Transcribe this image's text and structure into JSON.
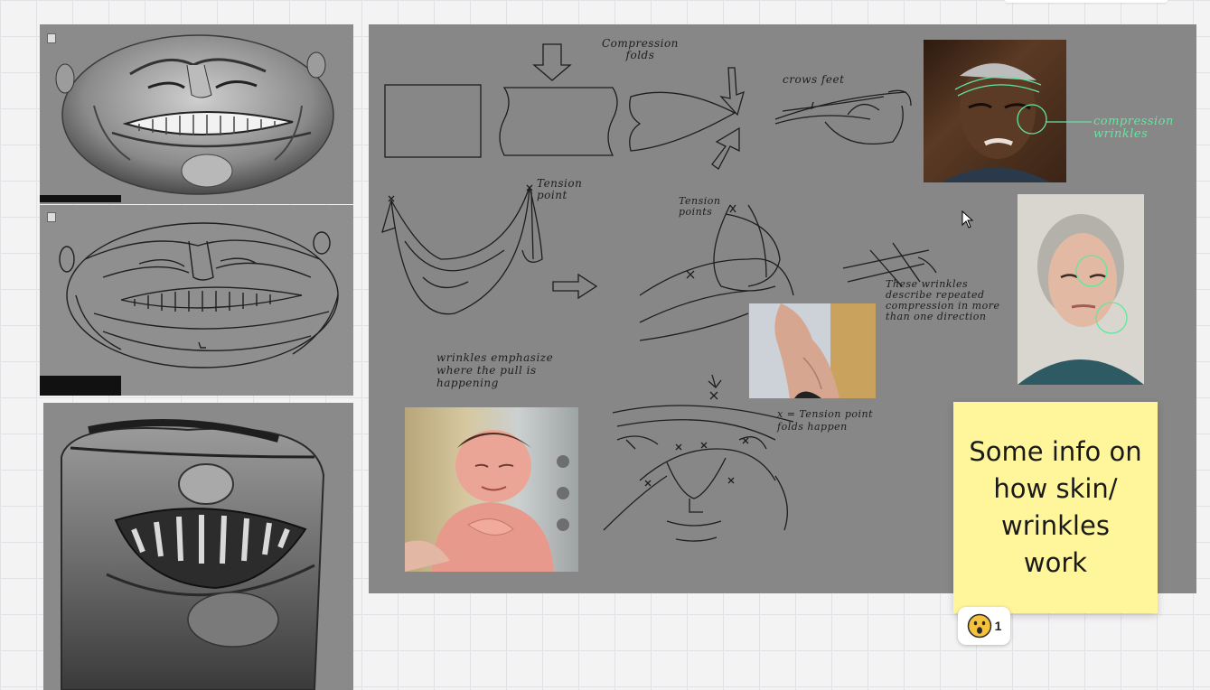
{
  "annotations": {
    "compression_folds": "Compression\nfolds",
    "crows_feet": "crows feet",
    "compression_wrinkles": "compression\nwrinkles",
    "tension_point_1": "Tension\npoint",
    "tension_points_2": "Tension\npoints",
    "wrinkles_emphasize": "wrinkles emphasize\nwhere the pull is\nhappening",
    "these_wrinkles": "These wrinkles\ndescribe repeated\ncompression in more\nthan one direction",
    "x_tension_point": "x = Tension point\nfolds happen"
  },
  "sticky_note": {
    "text": "Some info on\nhow skin/\nwrinkles\nwork",
    "color": "#fff59a"
  },
  "reaction": {
    "emoji": "😮",
    "count": "1"
  },
  "colors": {
    "board_background": "#f3f3f4",
    "frame_gray": "#878787",
    "annotation_green": "#62e6a0"
  },
  "icons": {
    "cursor": "cursor-arrow-icon"
  }
}
